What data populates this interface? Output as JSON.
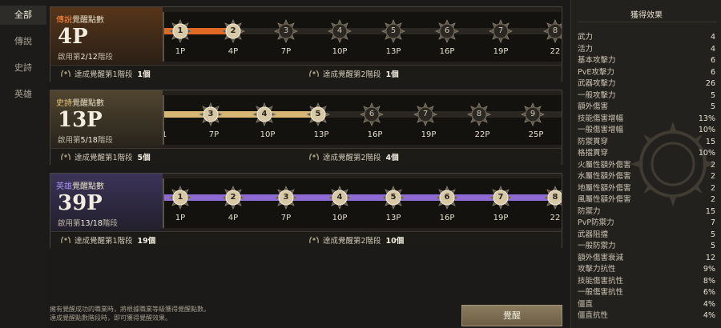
{
  "sidebar": {
    "items": [
      {
        "label": "全部",
        "active": true
      },
      {
        "label": "傳說",
        "active": false
      },
      {
        "label": "史詩",
        "active": false
      },
      {
        "label": "英雄",
        "active": false
      }
    ]
  },
  "panels": [
    {
      "title_type": "傳說",
      "title_rest": "覺醒點數",
      "points": "4P",
      "stage_pre": "啟用第",
      "stage_val": "2/12",
      "stage_post": "階段",
      "nodes": [
        "1",
        "2",
        "3",
        "4",
        "5",
        "6",
        "7",
        "8"
      ],
      "labels": [
        "1P",
        "4P",
        "7P",
        "10P",
        "13P",
        "16P",
        "19P",
        "22"
      ],
      "ach1_text": "達成覺醒第1階段",
      "ach1_count": "1個",
      "ach2_text": "達成覺醒第2階段",
      "ach2_count": "1個"
    },
    {
      "title_type": "史詩",
      "title_rest": "覺醒點數",
      "points": "13P",
      "stage_pre": "啟用第",
      "stage_val": "5/18",
      "stage_post": "階段",
      "nodes": [
        "3",
        "4",
        "5",
        "6",
        "7",
        "8",
        "9"
      ],
      "labels": [
        "1",
        "7P",
        "10P",
        "13P",
        "16P",
        "19P",
        "22P",
        "25P"
      ],
      "ach1_text": "達成覺醒第1階段",
      "ach1_count": "5個",
      "ach2_text": "達成覺醒第2階段",
      "ach2_count": "4個"
    },
    {
      "title_type": "英雄",
      "title_rest": "覺醒點數",
      "points": "39P",
      "stage_pre": "啟用第",
      "stage_val": "13/18",
      "stage_post": "階段",
      "nodes": [
        "1",
        "2",
        "3",
        "4",
        "5",
        "6",
        "7",
        "8"
      ],
      "labels": [
        "1P",
        "4P",
        "7P",
        "10P",
        "13P",
        "16P",
        "19P",
        "22"
      ],
      "ach1_text": "達成覺醒第1階段",
      "ach1_count": "19個",
      "ach2_text": "達成覺醒第2階段",
      "ach2_count": "10個"
    }
  ],
  "notes": {
    "line1": "擁有覺醒成功的職業時，將根據職業等級獲得覺醒點數。",
    "line2": "達成覺醒點數階段時，即可獲得覺醒效果。"
  },
  "awaken_button": "覺醒",
  "effects": {
    "title": "獲得效果",
    "stats": [
      {
        "k": "武力",
        "v": "4"
      },
      {
        "k": "活力",
        "v": "4"
      },
      {
        "k": "基本攻擊力",
        "v": "6"
      },
      {
        "k": "PvE攻擊力",
        "v": "6"
      },
      {
        "k": "武器攻擊力",
        "v": "26"
      },
      {
        "k": "一般攻擊力",
        "v": "5"
      },
      {
        "k": "額外傷害",
        "v": "5"
      },
      {
        "k": "技能傷害增幅",
        "v": "13%"
      },
      {
        "k": "一般傷害增幅",
        "v": "10%"
      },
      {
        "k": "防禦貫穿",
        "v": "15"
      },
      {
        "k": "格擋貫穿",
        "v": "10%"
      },
      {
        "k": "火屬性額外傷害",
        "v": "2"
      },
      {
        "k": "水屬性額外傷害",
        "v": "2"
      },
      {
        "k": "地屬性額外傷害",
        "v": "2"
      },
      {
        "k": "風屬性額外傷害",
        "v": "2"
      },
      {
        "k": "防禦力",
        "v": "15"
      },
      {
        "k": "PvP防禦力",
        "v": "7"
      },
      {
        "k": "武器阻擋",
        "v": "5"
      },
      {
        "k": "一般防禦力",
        "v": "5"
      },
      {
        "k": "額外傷害衰減",
        "v": "12"
      },
      {
        "k": "攻擊力抗性",
        "v": "9%"
      },
      {
        "k": "技能傷害抗性",
        "v": "8%"
      },
      {
        "k": "一般傷害抗性",
        "v": "6%"
      },
      {
        "k": "僵直",
        "v": "4%"
      },
      {
        "k": "僵直抗性",
        "v": "4%"
      }
    ]
  }
}
